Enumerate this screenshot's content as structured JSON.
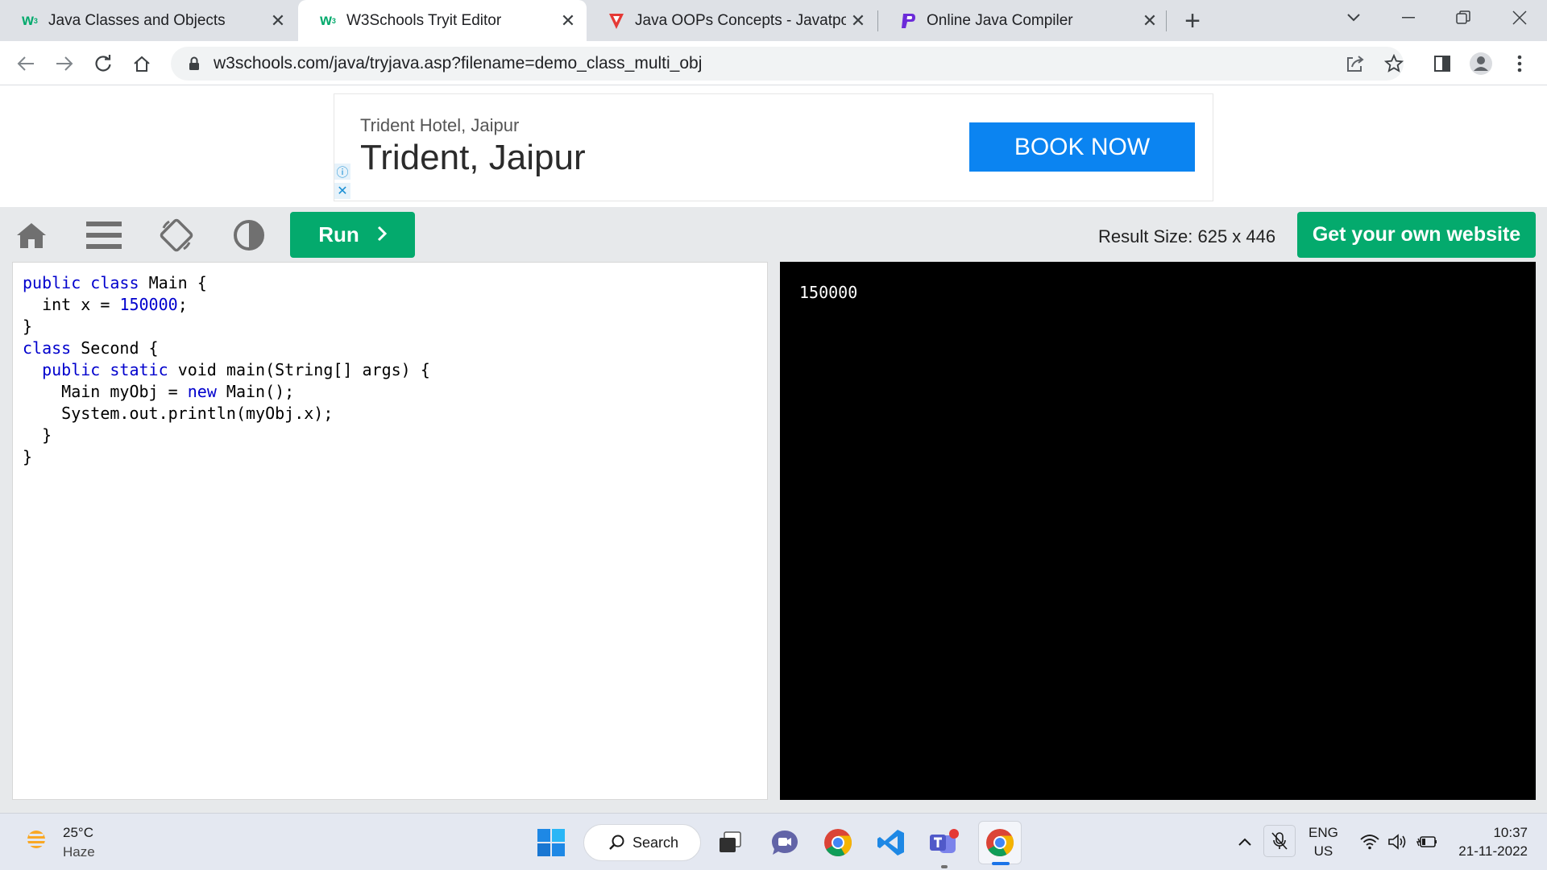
{
  "browser": {
    "tabs": [
      {
        "title": "Java Classes and Objects",
        "favicon": "w3schools-logo",
        "favicon_color": "#04aa6d"
      },
      {
        "title": "W3Schools Tryit Editor",
        "favicon": "w3schools-logo",
        "favicon_color": "#04aa6d",
        "active": true
      },
      {
        "title": "Java OOPs Concepts - Javatpoint",
        "favicon": "javatpoint-logo",
        "favicon_color": "#e53935"
      },
      {
        "title": "Online Java Compiler",
        "favicon": "programiz-logo",
        "favicon_color": "#6c2bd9"
      }
    ],
    "new_tab_label": "+",
    "url": "w3schools.com/java/tryjava.asp?filename=demo_class_multi_obj"
  },
  "ad": {
    "subtitle": "Trident Hotel, Jaipur",
    "headline": "Trident, Jaipur",
    "cta": "BOOK NOW",
    "cta_color": "#0b84f1"
  },
  "editor": {
    "run_label": "Run",
    "result_size_label": "Result Size: 625 x 446",
    "own_website_label": "Get your own website",
    "accent_color": "#04aa6d",
    "code_lines": [
      "public class Main {",
      "  int x = 150000;",
      "}",
      "class Second {",
      "  public static void main(String[] args) {",
      "    Main myObj = new Main();",
      "    System.out.println(myObj.x);",
      "  }",
      "}"
    ],
    "output": "150000"
  },
  "taskbar": {
    "weather_temp": "25°C",
    "weather_desc": "Haze",
    "search_label": "Search",
    "lang_line1": "ENG",
    "lang_line2": "US",
    "time": "10:37",
    "date": "21-11-2022"
  }
}
